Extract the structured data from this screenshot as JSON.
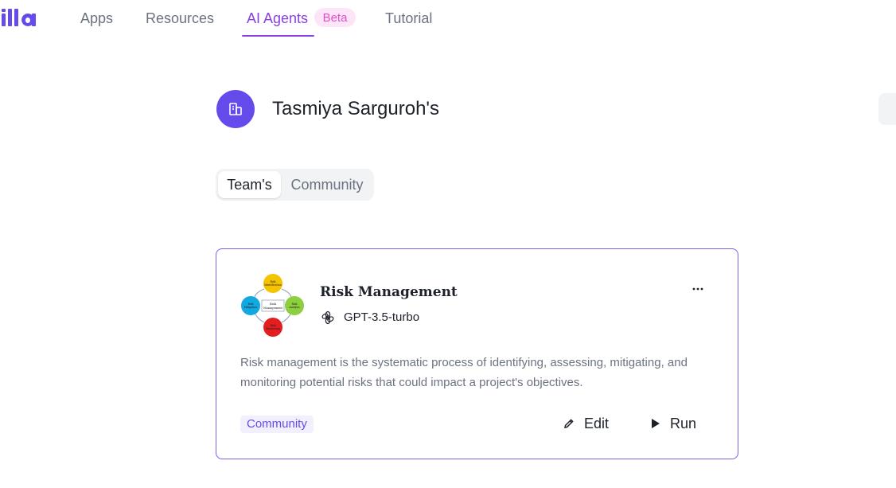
{
  "nav": {
    "logo_text": "illa",
    "items": [
      {
        "label": "Apps"
      },
      {
        "label": "Resources"
      },
      {
        "label": "AI Agents",
        "active": true
      },
      {
        "label": "Tutorial"
      }
    ],
    "beta_badge": "Beta",
    "accent_color": "#8b3fe0"
  },
  "team": {
    "name": "Tasmiya Sarguroh's",
    "avatar_color": "#654aec",
    "avatar_icon": "team-building-icon"
  },
  "tabs": {
    "active": "Team's",
    "inactive": "Community"
  },
  "card": {
    "title": "Risk Management",
    "model": "GPT-3.5-turbo",
    "model_icon": "openai-icon",
    "description": "Risk management is the systematic process of identifying, assessing, mitigating, and monitoring potential risks that could impact a project's objectives.",
    "tag": "Community",
    "edit_label": "Edit",
    "run_label": "Run",
    "more_icon": "ellipsis-icon",
    "border_color": "#7b61e8",
    "diagram": {
      "center_label": "Risk Management",
      "nodes": [
        {
          "label": "Risk Identification",
          "color": "#f5c400"
        },
        {
          "label": "Risk Analysis",
          "color": "#8dcf3f"
        },
        {
          "label": "Risk Monitoring",
          "color": "#e41e1e"
        },
        {
          "label": "Risk Mitigation",
          "color": "#12a9e0"
        }
      ]
    }
  }
}
